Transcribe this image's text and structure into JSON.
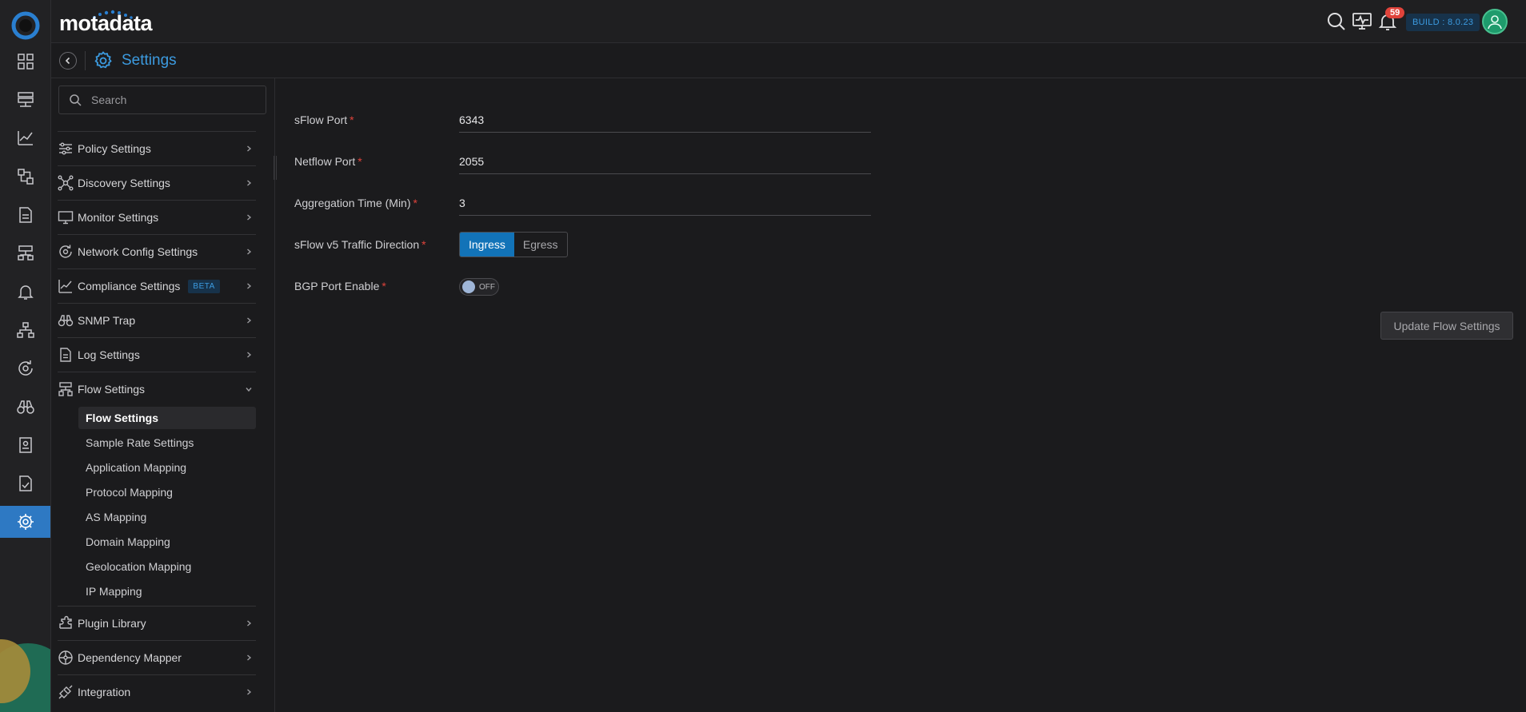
{
  "brand": {
    "name": "motadata"
  },
  "topbar": {
    "notification_count": "59",
    "build": "BUILD : 8.0.23"
  },
  "header": {
    "title": "Settings"
  },
  "search": {
    "placeholder": "Search"
  },
  "menu": {
    "items": [
      {
        "label": "Policy Settings",
        "icon": "sliders-icon"
      },
      {
        "label": "Discovery Settings",
        "icon": "discovery-icon"
      },
      {
        "label": "Monitor Settings",
        "icon": "monitor-icon"
      },
      {
        "label": "Network Config Settings",
        "icon": "network-config-icon"
      },
      {
        "label": "Compliance Settings",
        "icon": "compliance-icon",
        "badge": "BETA"
      },
      {
        "label": "SNMP Trap",
        "icon": "binoculars-icon"
      },
      {
        "label": "Log Settings",
        "icon": "log-icon"
      },
      {
        "label": "Flow Settings",
        "icon": "flow-icon",
        "expanded": true
      },
      {
        "label": "Plugin Library",
        "icon": "plugin-icon"
      },
      {
        "label": "Dependency Mapper",
        "icon": "dependency-icon"
      },
      {
        "label": "Integration",
        "icon": "integration-icon"
      }
    ],
    "flow_sub_items": [
      "Flow Settings",
      "Sample Rate Settings",
      "Application Mapping",
      "Protocol Mapping",
      "AS Mapping",
      "Domain Mapping",
      "Geolocation Mapping",
      "IP Mapping"
    ]
  },
  "form": {
    "sflow_port": {
      "label": "sFlow Port",
      "value": "6343"
    },
    "netflow_port": {
      "label": "Netflow Port",
      "value": "2055"
    },
    "aggregation_time": {
      "label": "Aggregation Time (Min)",
      "value": "3"
    },
    "traffic_direction": {
      "label": "sFlow v5 Traffic Direction",
      "options": [
        "Ingress",
        "Egress"
      ],
      "selected": "Ingress"
    },
    "bgp_port": {
      "label": "BGP Port Enable",
      "state": "OFF"
    },
    "required_marker": "*",
    "submit_label": "Update Flow Settings"
  },
  "colors": {
    "accent": "#3c9be0",
    "active_rail": "#2e79c3",
    "segment_on": "#1273b8",
    "required": "#e0433b"
  }
}
